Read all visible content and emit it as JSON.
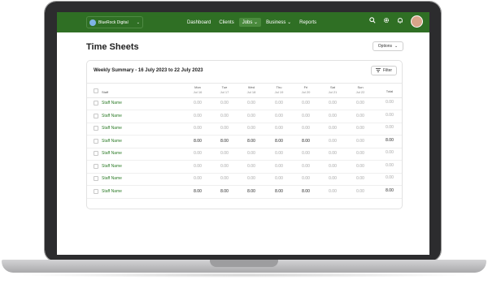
{
  "nav": {
    "org_name": "BlueRock Digital",
    "menu": [
      {
        "label": "Dashboard",
        "active": false
      },
      {
        "label": "Clients",
        "active": false
      },
      {
        "label": "Jobs",
        "active": true
      },
      {
        "label": "Business",
        "active": false
      },
      {
        "label": "Reports",
        "active": false
      }
    ]
  },
  "page": {
    "title": "Time Sheets",
    "options_label": "Options"
  },
  "card": {
    "title": "Weekly Summary - 16 July 2023 to 22 July 2023",
    "filter_label": "Filter",
    "columns": {
      "staff": "Staff",
      "total": "Total",
      "days": [
        {
          "name": "Mon",
          "date": "Jul 16"
        },
        {
          "name": "Tue",
          "date": "Jul 17"
        },
        {
          "name": "Wed",
          "date": "Jul 18"
        },
        {
          "name": "Thu",
          "date": "Jul 19"
        },
        {
          "name": "Fri",
          "date": "Jul 20"
        },
        {
          "name": "Sat",
          "date": "Jul 21"
        },
        {
          "name": "Sun",
          "date": "Jul 22"
        }
      ]
    },
    "rows": [
      {
        "staff": "Staff Name",
        "hours": [
          "0.00",
          "0.00",
          "0.00",
          "0.00",
          "0.00",
          "0.00",
          "0.00"
        ],
        "total": "0.00"
      },
      {
        "staff": "Staff Name",
        "hours": [
          "0.00",
          "0.00",
          "0.00",
          "0.00",
          "0.00",
          "0.00",
          "0.00"
        ],
        "total": "0.00"
      },
      {
        "staff": "Staff Name",
        "hours": [
          "0.00",
          "0.00",
          "0.00",
          "0.00",
          "0.00",
          "0.00",
          "0.00"
        ],
        "total": "0.00"
      },
      {
        "staff": "Staff Name",
        "hours": [
          "8.00",
          "8.00",
          "8.00",
          "8.00",
          "8.00",
          "0.00",
          "0.00"
        ],
        "total": "8.00"
      },
      {
        "staff": "Staff Name",
        "hours": [
          "0.00",
          "0.00",
          "0.00",
          "0.00",
          "0.00",
          "0.00",
          "0.00"
        ],
        "total": "0.00"
      },
      {
        "staff": "Staff Name",
        "hours": [
          "0.00",
          "0.00",
          "0.00",
          "0.00",
          "0.00",
          "0.00",
          "0.00"
        ],
        "total": "0.00"
      },
      {
        "staff": "Staff Name",
        "hours": [
          "0.00",
          "0.00",
          "0.00",
          "0.00",
          "0.00",
          "0.00",
          "0.00"
        ],
        "total": "0.00"
      },
      {
        "staff": "Staff Name",
        "hours": [
          "8.00",
          "8.00",
          "8.00",
          "8.00",
          "8.00",
          "0.00",
          "0.00"
        ],
        "total": "8.00"
      }
    ]
  },
  "colors": {
    "nav": "#2f6f24",
    "accent_text": "#2f7d2a",
    "muted": "#a7a7a7"
  },
  "icons": [
    "search-icon",
    "gear-icon",
    "bell-icon",
    "chevron-down-icon",
    "filter-icon"
  ]
}
